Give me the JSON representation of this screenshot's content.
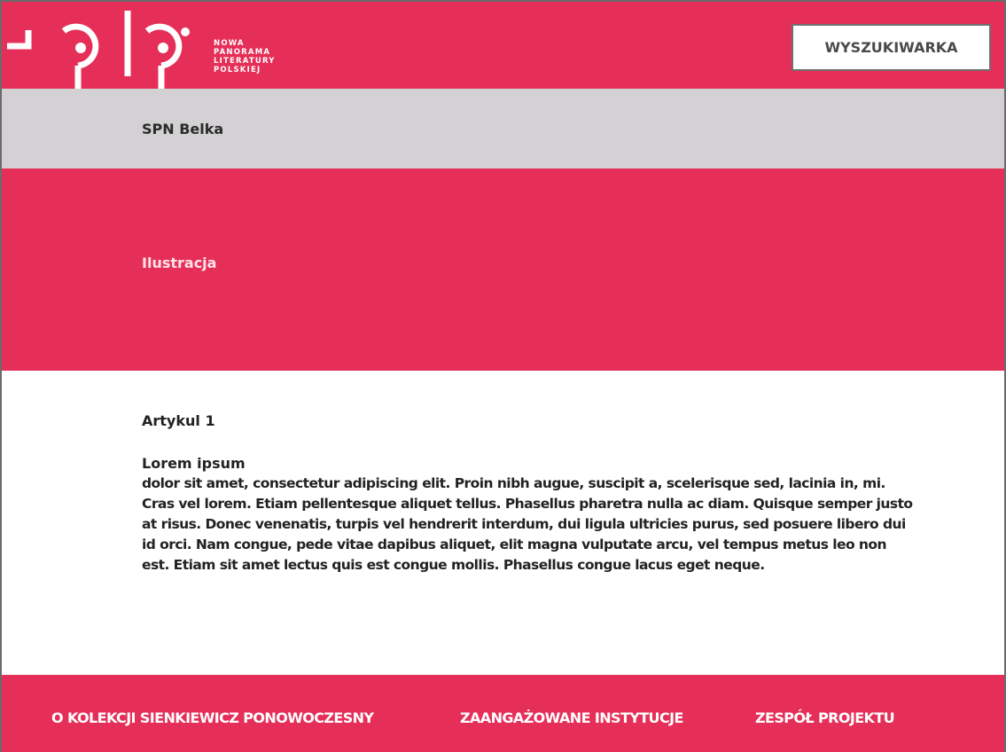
{
  "header": {
    "logo": {
      "lines": [
        "NOWA",
        "PANORAMA",
        "LITERATURY",
        "POLSKIEJ"
      ]
    },
    "search_button_label": "WYSZUKIWARKA"
  },
  "belka": {
    "label": "SPN Belka"
  },
  "illustration": {
    "label": "Ilustracja"
  },
  "article": {
    "title": "Artykul 1",
    "heading": "Lorem ipsum",
    "body": "dolor sit amet, consectetur adipiscing elit. Proin nibh augue, suscipit a, scelerisque sed, lacinia in, mi. Cras vel lorem. Etiam pellentesque aliquet tellus. Phasellus pharetra nulla ac diam. Quisque semper justo at risus. Donec venenatis, turpis vel hendrerit interdum, dui ligula ultricies purus, sed posuere libero dui id orci. Nam congue, pede vitae dapibus aliquet, elit magna vulputate arcu, vel tempus metus leo non est. Etiam sit amet lectus quis est congue mollis. Phasellus congue lacus eget neque."
  },
  "footer": {
    "links": [
      "O KOLEKCJI SIENKIEWICZ PONOWOCZESNY",
      "ZAANGAŻOWANE INSTYTUCJE",
      "ZESPÓŁ PROJEKTU"
    ]
  },
  "colors": {
    "brand": "#e52f58",
    "grey_bar": "#d3d1d3",
    "text_dark": "#222222",
    "white": "#ffffff"
  }
}
